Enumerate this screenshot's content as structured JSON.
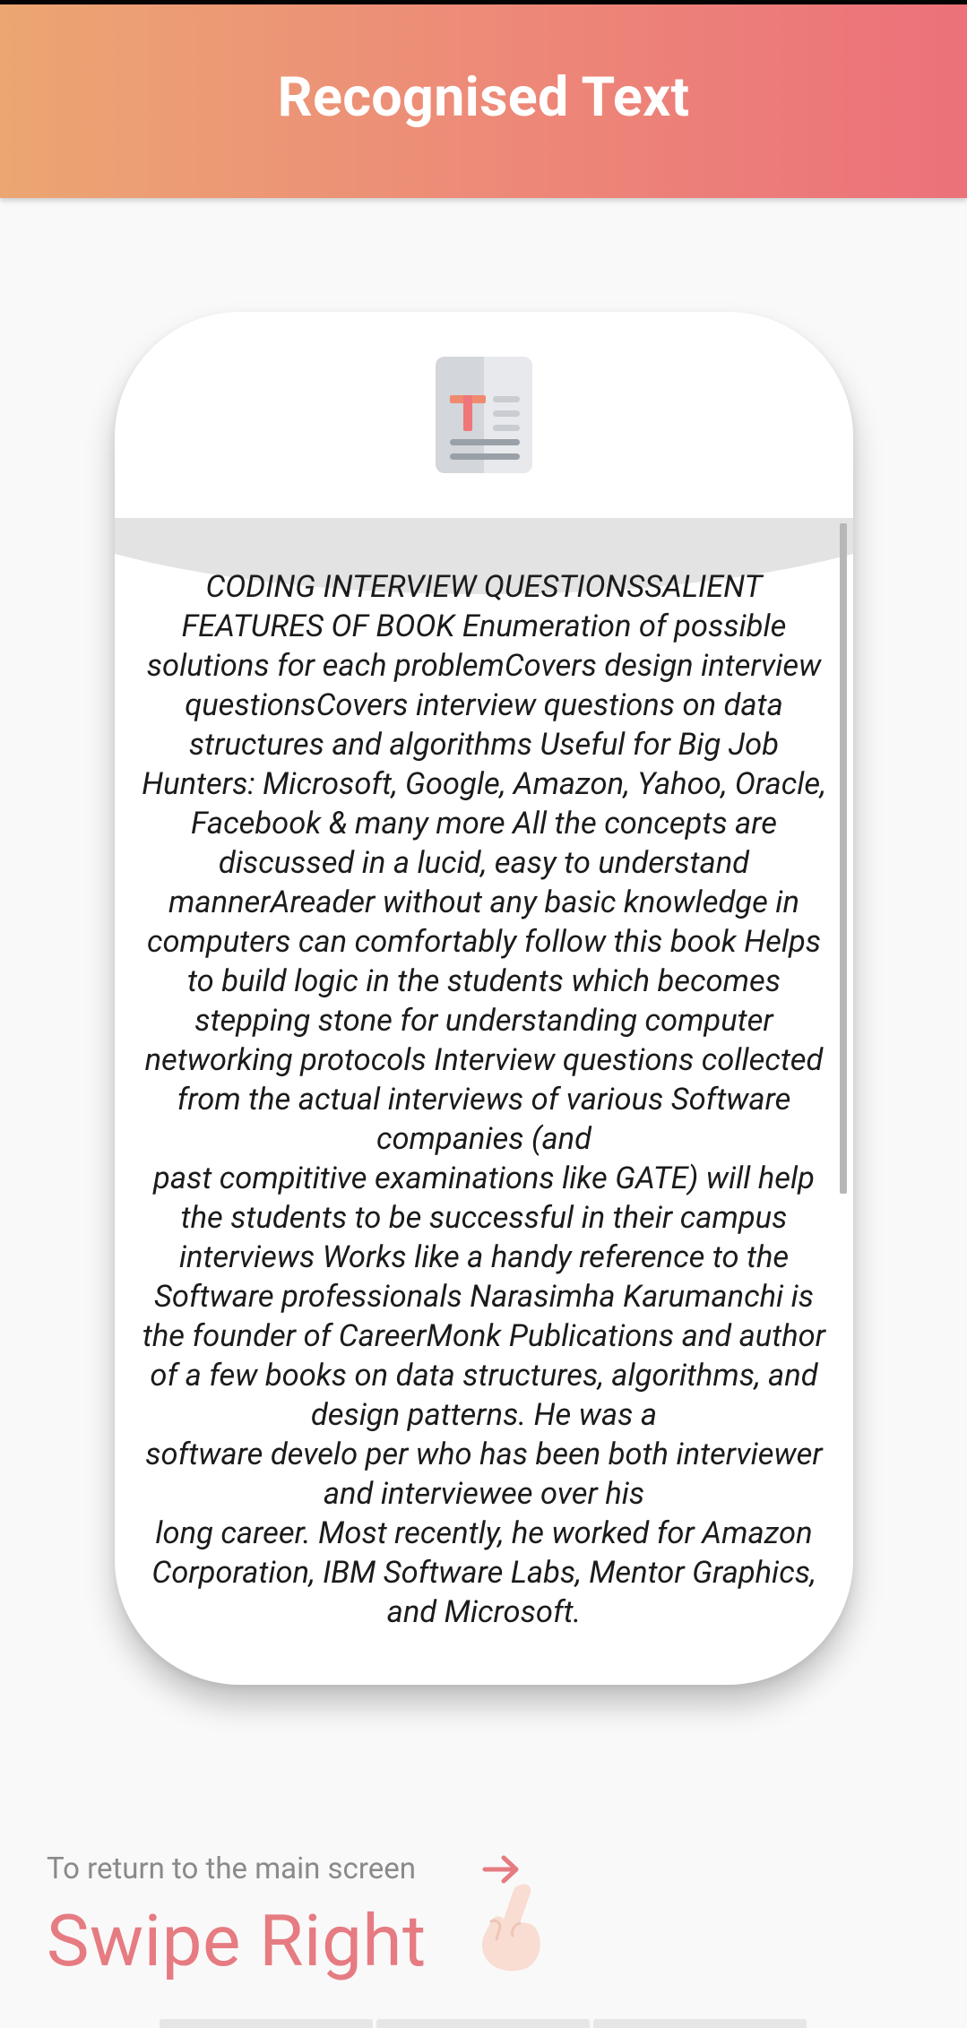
{
  "header": {
    "title": "Recognised Text"
  },
  "card": {
    "icon": "text-document-icon",
    "recognised_text": "CODING INTERVIEW QUESTIONSSALIENT FEATURES OF BOOK Enumeration of possible solutions for each problemCovers design interview questionsCovers interview questions on data structures and algorithms Useful for Big Job Hunters: Microsoft, Google, Amazon, Yahoo, Oracle, Facebook & many more  All the concepts are discussed in a lucid, easy to understand mannerAreader without any basic knowledge in computers can comfortably follow this book  Helps to build logic in the students which becomes stepping stone for understanding computer\nnetworking protocols  Interview questions collected from the actual interviews of various Software companies (and\npast compititive examinations like GATE) will help the students to be successful in their campus\ninterviews  Works like a handy reference to the Software professionals   Narasimha Karumanchi is the founder of CareerMonk Publications and author  of a few books on data structures, algorithms, and design patterns. He was a\nsoftware develo per who has been both interviewer and interviewee over his\nlong career. Most recently, he worked for Amazon Corporation, IBM Software Labs, Mentor Graphics, and Microsoft."
  },
  "footer": {
    "hint": "To return to the main screen",
    "action": "Swipe Right",
    "arrow_icon": "arrow-right-icon",
    "hand_icon": "swipe-hand-icon"
  },
  "colors": {
    "header_gradient_start": "#eba672",
    "header_gradient_end": "#ec717a",
    "accent": "#e67b82",
    "hint_text": "#8a8a8a"
  }
}
